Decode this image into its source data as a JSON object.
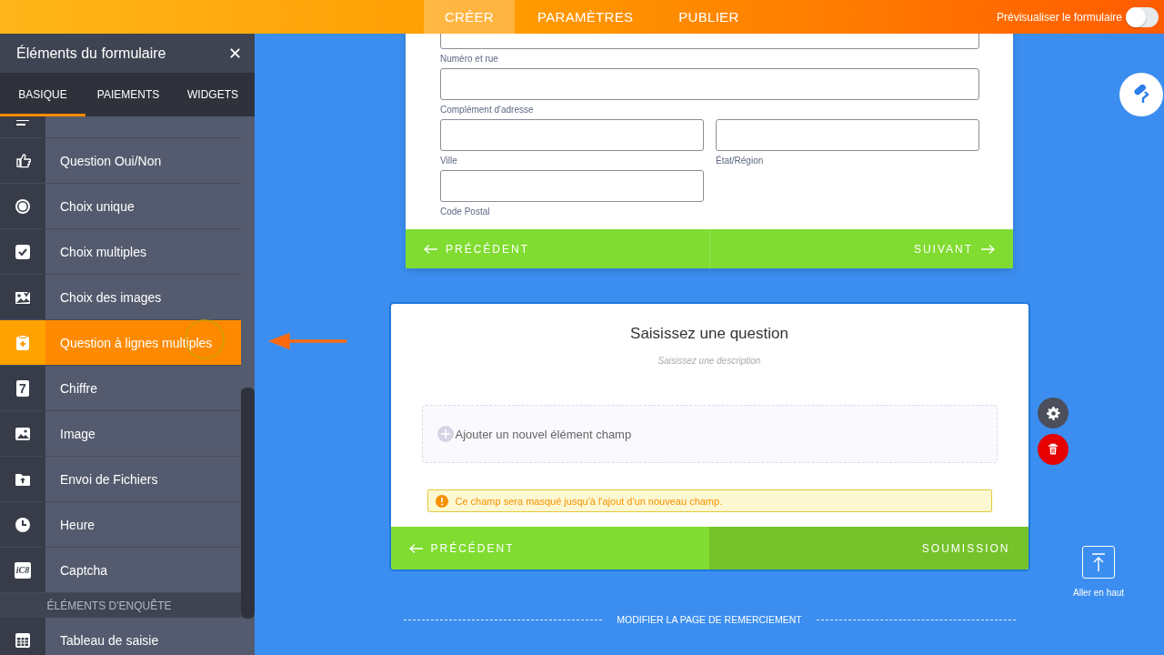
{
  "top_bar": {
    "tabs": [
      {
        "label": "CRÉER",
        "selected": true
      },
      {
        "label": "PARAMÈTRES",
        "selected": false
      },
      {
        "label": "PUBLIER",
        "selected": false
      }
    ],
    "preview": {
      "label": "Prévisualiser le formulaire",
      "on": false
    }
  },
  "sidebar": {
    "title": "Éléments du formulaire",
    "close": "✕",
    "tabs": [
      {
        "label": "BASIQUE",
        "selected": true
      },
      {
        "label": "PAIEMENTS",
        "selected": false
      },
      {
        "label": "WIDGETS",
        "selected": false
      }
    ],
    "items": [
      {
        "kind": "element",
        "selected": false
      },
      {
        "kind": "element",
        "label": "Question Oui/Non",
        "selected": false
      },
      {
        "kind": "element",
        "label": "Choix unique",
        "selected": false
      },
      {
        "kind": "element",
        "label": "Choix multiples",
        "selected": false
      },
      {
        "kind": "element",
        "label": "Choix des images",
        "selected": false
      },
      {
        "kind": "element",
        "label": "Question à lignes multiples",
        "selected": true
      },
      {
        "kind": "element",
        "label": "Chiffre",
        "icon_char": "7",
        "selected": false
      },
      {
        "kind": "element",
        "label": "Image",
        "selected": false
      },
      {
        "kind": "element",
        "label": "Envoi de Fichiers",
        "selected": false
      },
      {
        "kind": "element",
        "label": "Heure",
        "selected": false
      },
      {
        "kind": "element",
        "label": "Captcha",
        "icon_char": "iC8",
        "selected": false
      },
      {
        "kind": "section",
        "label": "ÉLÉMENTS D'ENQUÊTE"
      },
      {
        "kind": "element",
        "label": "Tableau de saisie",
        "selected": false
      }
    ]
  },
  "page_1": {
    "fields": [
      {
        "kind": "full",
        "label": "Numéro et rue"
      },
      {
        "kind": "full",
        "label": "Complément d'adresse"
      },
      {
        "kind": "half",
        "label": "Ville"
      },
      {
        "kind": "half",
        "label": "État/Région"
      },
      {
        "kind": "half",
        "label": "Code Postal"
      }
    ],
    "previous": "PRÉCÉDENT",
    "next": "SUIVANT"
  },
  "page_2": {
    "question": "Saisissez une question",
    "description": "Saisissez une description",
    "add_field": "Ajouter un nouvel élément champ",
    "warning": "Ce champ sera masqué jusqu'à l'ajout d'un nouveau champ.",
    "previous": "PRÉCÉDENT",
    "submit": "SOUMISSION"
  },
  "scroll_top": "Aller en haut",
  "thank_you": "MODIFIER LA PAGE DE REMERCIEMENT"
}
